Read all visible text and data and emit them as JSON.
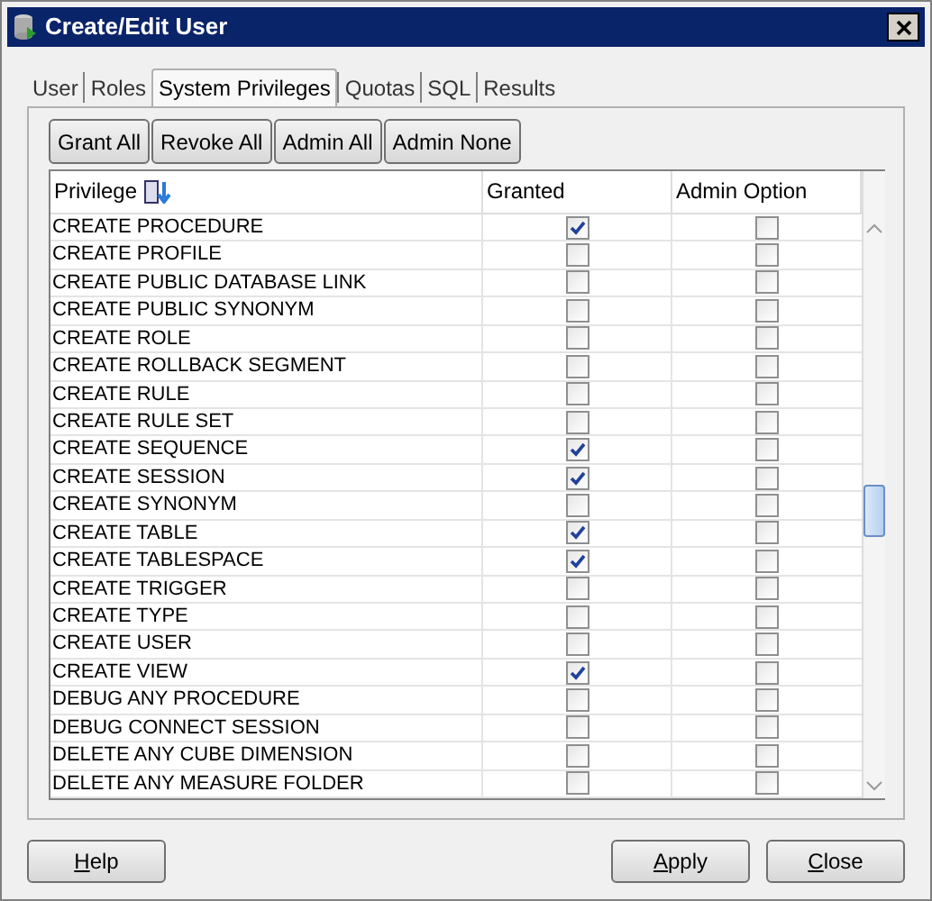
{
  "window": {
    "title": "Create/Edit User"
  },
  "tabs": [
    {
      "label": "User",
      "selected": false
    },
    {
      "label": "Roles",
      "selected": false
    },
    {
      "label": "System Privileges",
      "selected": true
    },
    {
      "label": "Quotas",
      "selected": false
    },
    {
      "label": "SQL",
      "selected": false
    },
    {
      "label": "Results",
      "selected": false
    }
  ],
  "toolbar": [
    "Grant All",
    "Revoke All",
    "Admin All",
    "Admin None"
  ],
  "table": {
    "columns": [
      "Privilege",
      "Granted",
      "Admin Option"
    ],
    "rows": [
      {
        "privilege": "CREATE PROCEDURE",
        "granted": true,
        "admin": false
      },
      {
        "privilege": "CREATE PROFILE",
        "granted": false,
        "admin": false
      },
      {
        "privilege": "CREATE PUBLIC DATABASE LINK",
        "granted": false,
        "admin": false
      },
      {
        "privilege": "CREATE PUBLIC SYNONYM",
        "granted": false,
        "admin": false
      },
      {
        "privilege": "CREATE ROLE",
        "granted": false,
        "admin": false
      },
      {
        "privilege": "CREATE ROLLBACK SEGMENT",
        "granted": false,
        "admin": false
      },
      {
        "privilege": "CREATE RULE",
        "granted": false,
        "admin": false
      },
      {
        "privilege": "CREATE RULE SET",
        "granted": false,
        "admin": false
      },
      {
        "privilege": "CREATE SEQUENCE",
        "granted": true,
        "admin": false
      },
      {
        "privilege": "CREATE SESSION",
        "granted": true,
        "admin": false
      },
      {
        "privilege": "CREATE SYNONYM",
        "granted": false,
        "admin": false
      },
      {
        "privilege": "CREATE TABLE",
        "granted": true,
        "admin": false
      },
      {
        "privilege": "CREATE TABLESPACE",
        "granted": true,
        "admin": false
      },
      {
        "privilege": "CREATE TRIGGER",
        "granted": false,
        "admin": false
      },
      {
        "privilege": "CREATE TYPE",
        "granted": false,
        "admin": false
      },
      {
        "privilege": "CREATE USER",
        "granted": false,
        "admin": false
      },
      {
        "privilege": "CREATE VIEW",
        "granted": true,
        "admin": false
      },
      {
        "privilege": "DEBUG ANY PROCEDURE",
        "granted": false,
        "admin": false
      },
      {
        "privilege": "DEBUG CONNECT SESSION",
        "granted": false,
        "admin": false
      },
      {
        "privilege": "DELETE ANY CUBE DIMENSION",
        "granted": false,
        "admin": false
      },
      {
        "privilege": "DELETE ANY MEASURE FOLDER",
        "granted": false,
        "admin": false
      }
    ]
  },
  "buttons": [
    {
      "label": "Help"
    },
    {
      "label": "Apply"
    },
    {
      "label": "Close"
    }
  ]
}
